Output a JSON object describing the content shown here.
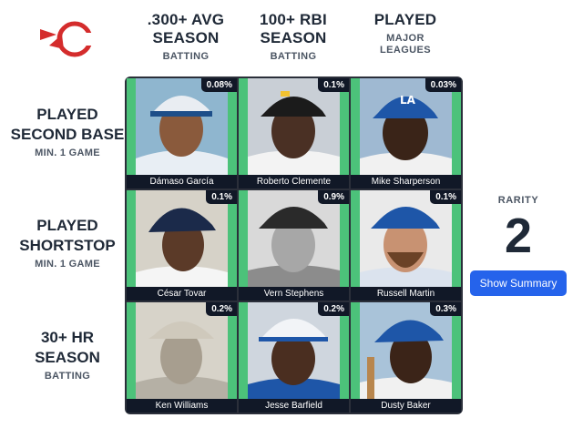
{
  "colors": {
    "accent": "#2563eb",
    "cell_green": "#4cc27a",
    "dark": "#111827",
    "logo_red": "#d42c2c"
  },
  "logo": {
    "icon": "baseball-logo-icon"
  },
  "columns": [
    {
      "title_line1": ".300+ AVG",
      "title_line2": "SEASON",
      "sub_line1": "BATTING",
      "sub_line2": ""
    },
    {
      "title_line1": "100+ RBI",
      "title_line2": "SEASON",
      "sub_line1": "BATTING",
      "sub_line2": ""
    },
    {
      "title_line1": "PLAYED",
      "title_line2": "",
      "sub_line1": "MAJOR",
      "sub_line2": "LEAGUES"
    }
  ],
  "rows": [
    {
      "title_line1": "PLAYED",
      "title_line2": "SECOND BASE",
      "sub": "MIN. 1 GAME"
    },
    {
      "title_line1": "PLAYED",
      "title_line2": "SHORTSTOP",
      "sub": "MIN. 1 GAME"
    },
    {
      "title_line1": "30+ HR",
      "title_line2": "SEASON",
      "sub": "BATTING"
    }
  ],
  "cells": [
    {
      "name": "Dámaso García",
      "pct": "0.08%"
    },
    {
      "name": "Roberto Clemente",
      "pct": "0.1%"
    },
    {
      "name": "Mike Sharperson",
      "pct": "0.03%"
    },
    {
      "name": "César Tovar",
      "pct": "0.1%"
    },
    {
      "name": "Vern Stephens",
      "pct": "0.9%"
    },
    {
      "name": "Russell Martin",
      "pct": "0.1%"
    },
    {
      "name": "Ken Williams",
      "pct": "0.2%"
    },
    {
      "name": "Jesse Barfield",
      "pct": "0.2%"
    },
    {
      "name": "Dusty Baker",
      "pct": "0.3%"
    }
  ],
  "rarity": {
    "label": "RARITY",
    "value": "2"
  },
  "summary_button": {
    "label": "Show Summary"
  }
}
